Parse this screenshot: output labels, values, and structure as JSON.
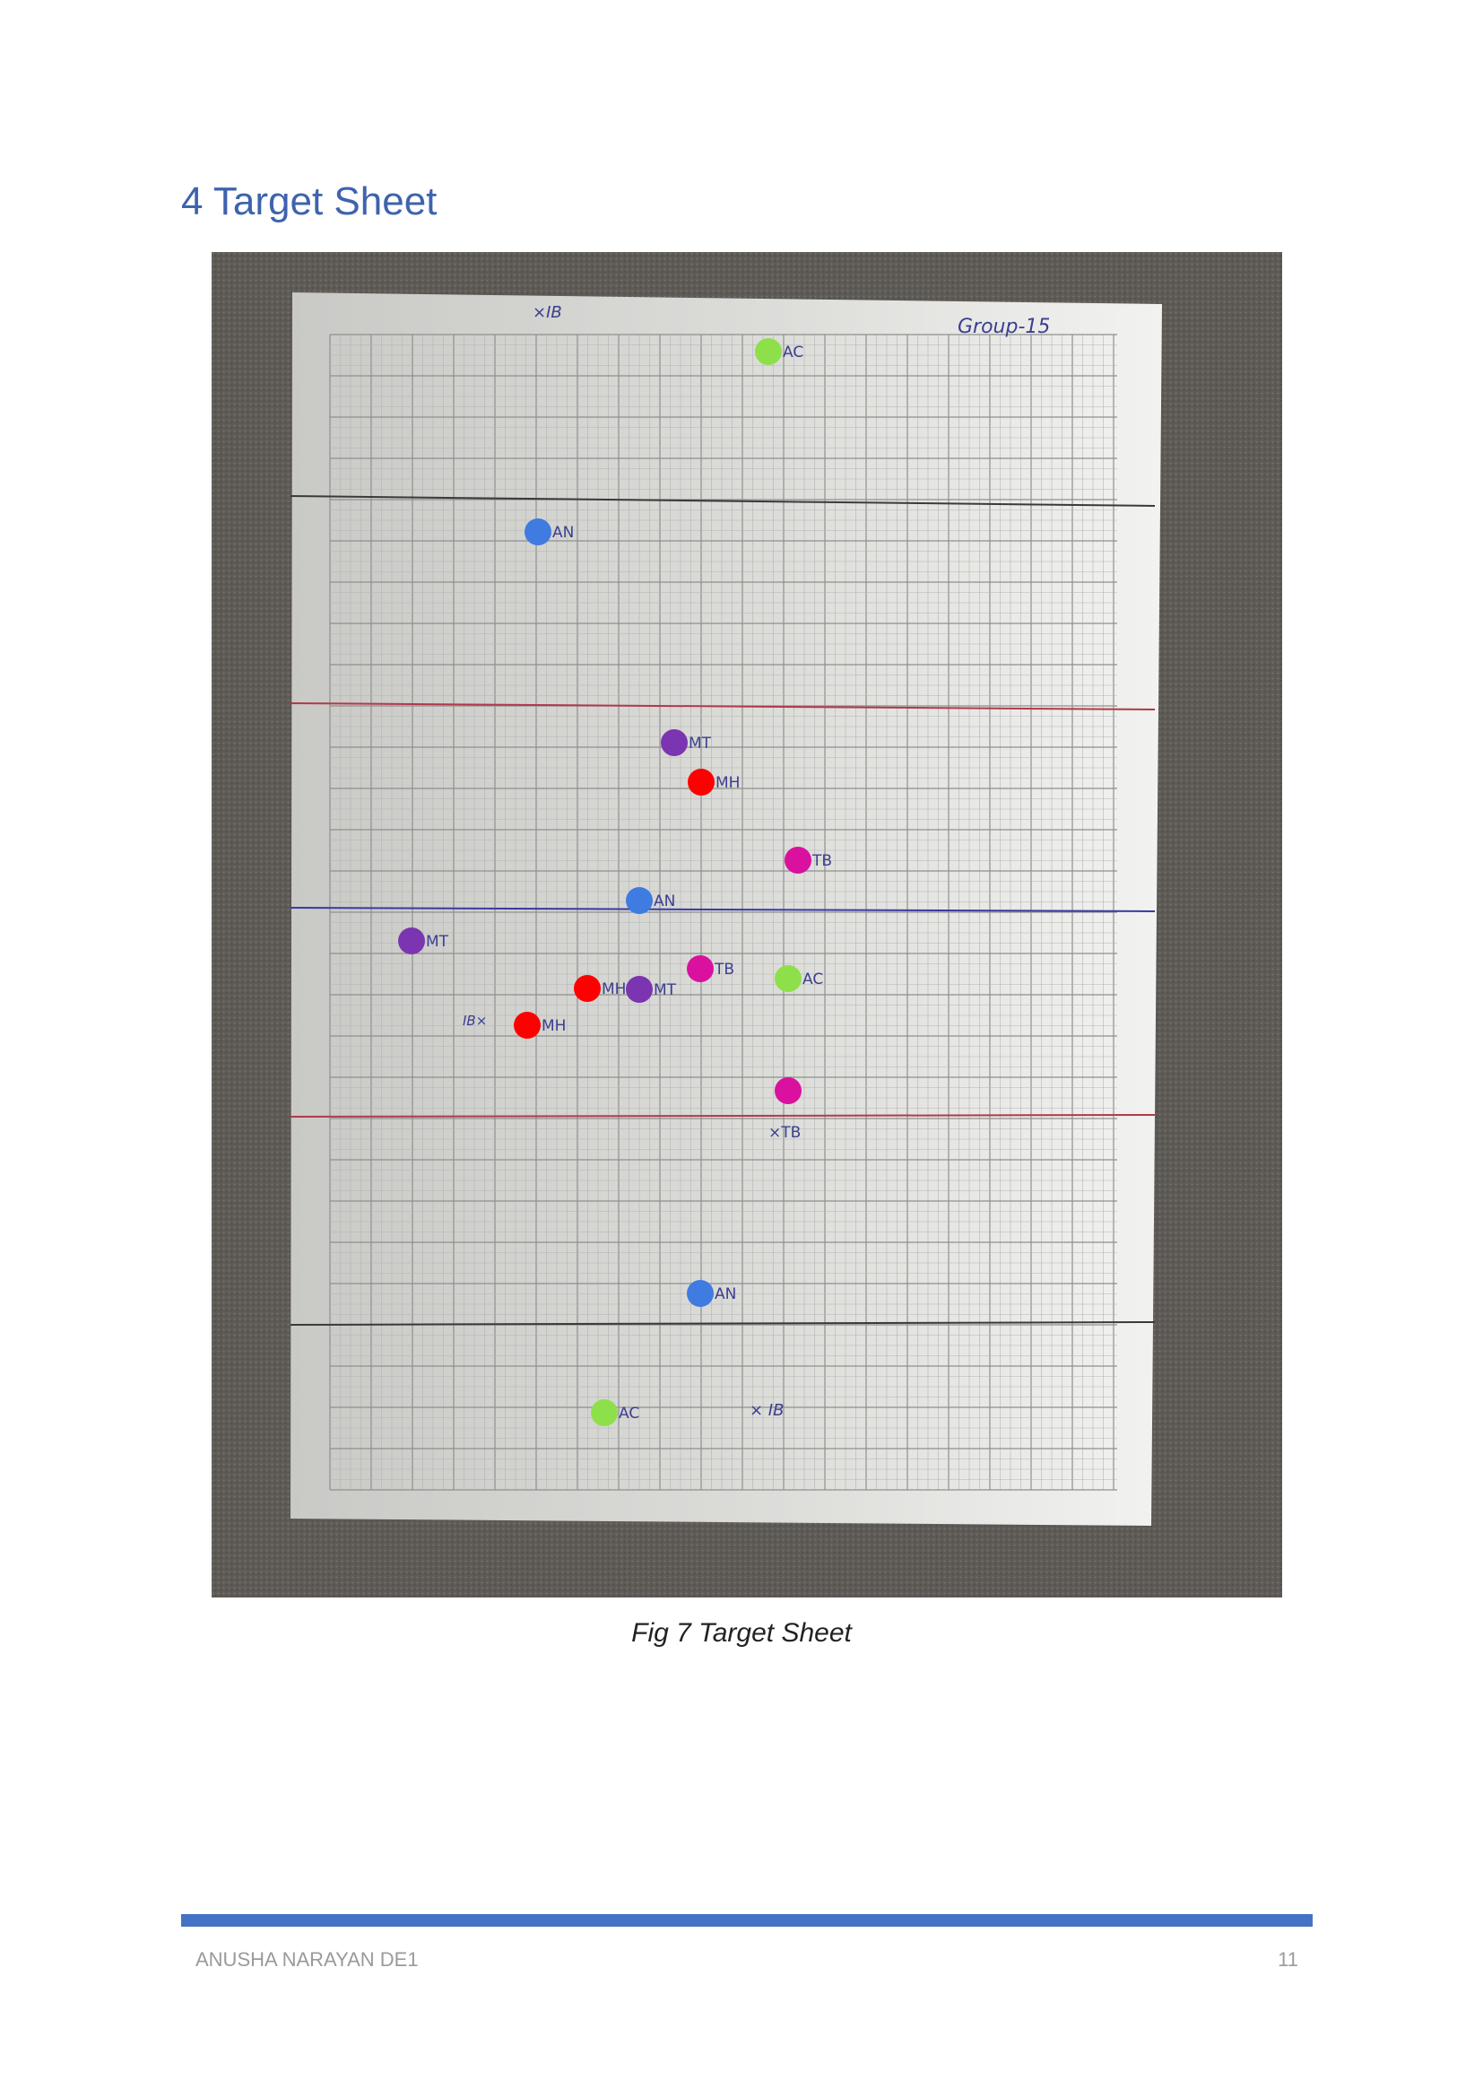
{
  "heading": "4 Target Sheet",
  "figure": {
    "caption": "Fig 7 Target Sheet",
    "sheet": {
      "group_label": "Group-15",
      "top_mark": "×IB",
      "bottom_mark": "× IB",
      "left_mark": "IB×",
      "colors": {
        "AN": "#3F7BE0",
        "AC": "#8DE04A",
        "MT": "#7B35B0",
        "MH": "#FF0000",
        "TB": "#D9119E"
      },
      "marks": [
        {
          "color": "AC",
          "label": "AC"
        },
        {
          "color": "AN",
          "label": "AN"
        },
        {
          "color": "MT",
          "label": "MT"
        },
        {
          "color": "MH",
          "label": "MH"
        },
        {
          "color": "TB",
          "label": "TB"
        },
        {
          "color": "AN",
          "label": "AN"
        },
        {
          "color": "MT",
          "label": "MT"
        },
        {
          "color": "TB",
          "label": "TB"
        },
        {
          "color": "AC",
          "label": "AC"
        },
        {
          "color": "MH",
          "label": "MH"
        },
        {
          "color": "MT",
          "label": "MT"
        },
        {
          "color": "MH",
          "label": "MH"
        },
        {
          "color": "TB",
          "label": "×TB"
        },
        {
          "color": "AN",
          "label": "AN"
        },
        {
          "color": "AC",
          "label": "AC"
        }
      ]
    }
  },
  "footer": {
    "author": "ANUSHA NARAYAN DE1",
    "page_number": "11"
  }
}
